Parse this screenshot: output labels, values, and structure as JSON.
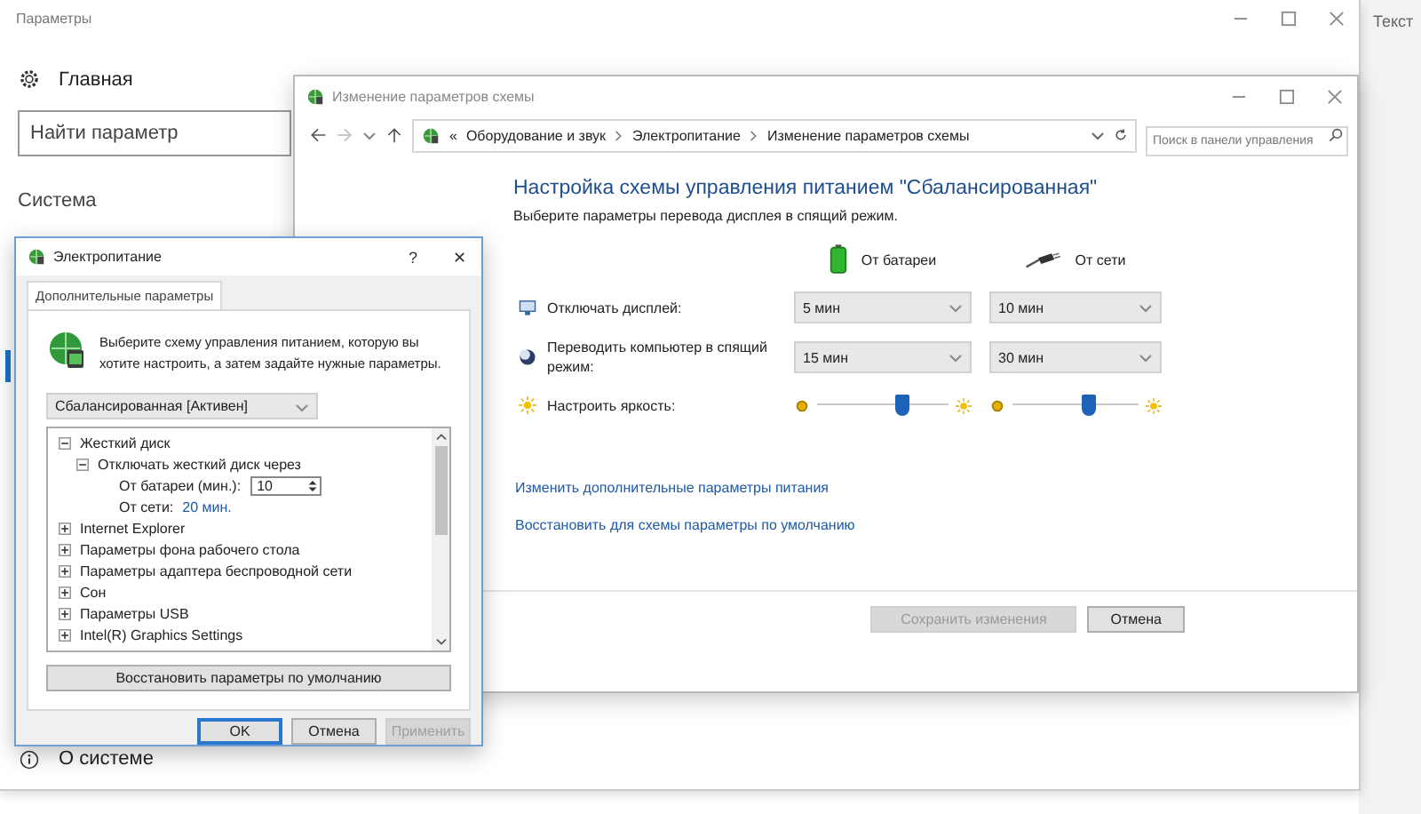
{
  "settings_window": {
    "title": "Параметры",
    "home": "Главная",
    "search": {
      "placeholder": "Найти параметр"
    },
    "section": "Система",
    "about": "О системе"
  },
  "side_window": {
    "label": "Текст"
  },
  "control_panel": {
    "title": "Изменение параметров схемы",
    "breadcrumb_prefix": "«",
    "breadcrumb": [
      "Оборудование и звук",
      "Электропитание",
      "Изменение параметров схемы"
    ],
    "search": {
      "placeholder": "Поиск в панели управления"
    },
    "heading": "Настройка схемы управления питанием \"Сбалансированная\"",
    "subtitle": "Выберите параметры перевода дисплея в спящий режим.",
    "columns": [
      "От батареи",
      "От сети"
    ],
    "rows": [
      {
        "kind": "select",
        "label": "Отключать дисплей:",
        "values": [
          "5 мин",
          "10 мин"
        ]
      },
      {
        "kind": "select",
        "label": "Переводить компьютер в спящий режим:",
        "values": [
          "15 мин",
          "30 мин"
        ]
      },
      {
        "kind": "slider",
        "label": "Настроить яркость:",
        "sliders": [
          {
            "level": 0.65
          },
          {
            "level": 0.6
          }
        ]
      }
    ],
    "links": [
      "Изменить дополнительные параметры питания",
      "Восстановить для схемы параметры по умолчанию"
    ],
    "buttons": [
      {
        "label": "Сохранить изменения",
        "disabled": true
      },
      {
        "label": "Отмена",
        "disabled": false
      }
    ]
  },
  "dialog": {
    "title": "Электропитание",
    "help": "?",
    "close": "✕",
    "tabs": [
      {
        "label": "Дополнительные параметры",
        "selected": true
      }
    ],
    "intro": "Выберите схему управления питанием, которую вы хотите настроить, а затем задайте нужные параметры.",
    "scheme": "Сбалансированная [Активен]",
    "tree": [
      {
        "label": "Жесткий диск",
        "expanded": true,
        "children": [
          {
            "label": "Отключать жесткий диск через",
            "expanded": true,
            "children": [
              {
                "kind": "spin",
                "label": "От батареи (мин.):",
                "value": "10"
              },
              {
                "kind": "link",
                "label": "От сети:",
                "value": "20 мин."
              }
            ]
          }
        ]
      },
      {
        "label": "Internet Explorer",
        "expanded": false
      },
      {
        "label": "Параметры фона рабочего стола",
        "expanded": false
      },
      {
        "label": "Параметры адаптера беспроводной сети",
        "expanded": false
      },
      {
        "label": "Сон",
        "expanded": false
      },
      {
        "label": "Параметры USB",
        "expanded": false
      },
      {
        "label": "Intel(R) Graphics Settings",
        "expanded": false
      }
    ],
    "restore": "Восстановить параметры по умолчанию",
    "buttons": [
      {
        "label": "OK",
        "default": true,
        "disabled": false
      },
      {
        "label": "Отмена",
        "default": false,
        "disabled": false
      },
      {
        "label": "Применить",
        "default": false,
        "disabled": true
      }
    ]
  }
}
